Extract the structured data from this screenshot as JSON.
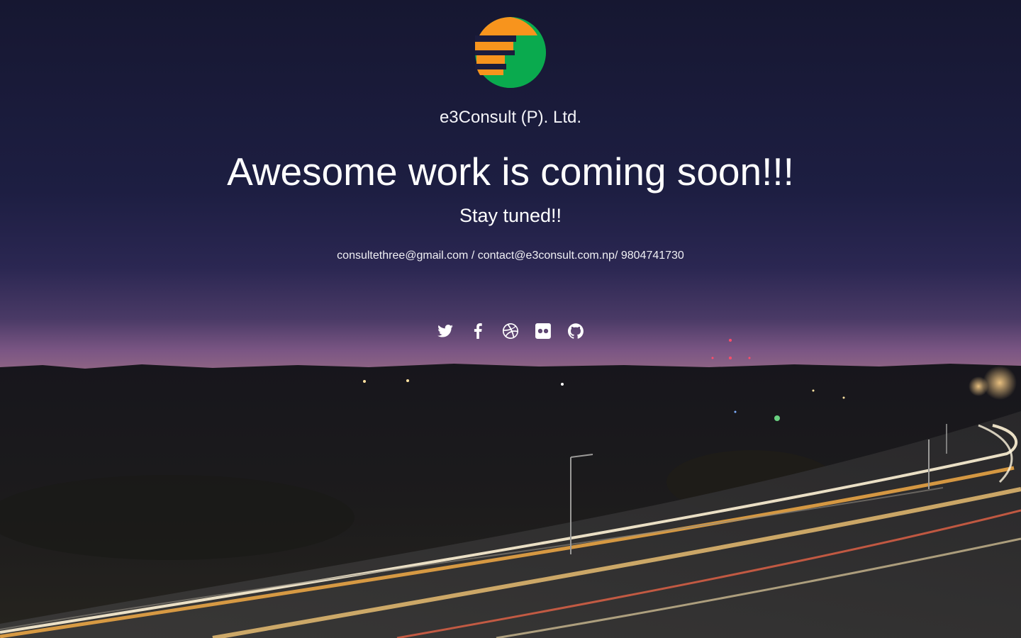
{
  "brand": {
    "company_name": "e3Consult (P). Ltd.",
    "logo_icon": "e3-logo",
    "logo_colors": {
      "orange": "#f7941d",
      "green": "#0aaa4e"
    }
  },
  "hero": {
    "headline": "Awesome work is coming soon!!!",
    "tagline": "Stay tuned!!",
    "contact": "consultethree@gmail.com / contact@e3consult.com.np/ 9804741730"
  },
  "social": {
    "items": [
      {
        "icon": "twitter-icon"
      },
      {
        "icon": "facebook-icon"
      },
      {
        "icon": "dribbble-icon"
      },
      {
        "icon": "flickr-icon"
      },
      {
        "icon": "github-icon"
      }
    ]
  },
  "background": {
    "description_icon": "night-highway-photo",
    "sky_top": "#161833",
    "horizon_glow": "#8a5a8e"
  }
}
